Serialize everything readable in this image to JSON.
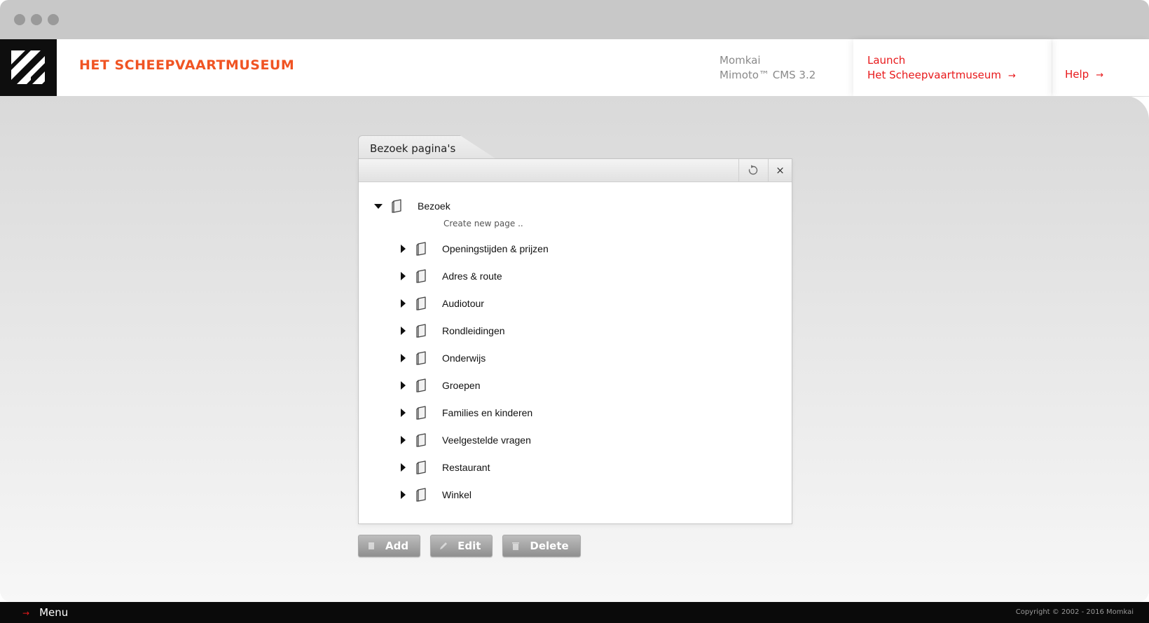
{
  "header": {
    "brand": "HET SCHEEPVAARTMUSEUM",
    "cms_vendor": "Momkai",
    "cms_name": "Mimoto™ CMS 3.2",
    "launch_line1": "Launch",
    "launch_line2": "Het Scheepvaartmuseum",
    "help": "Help",
    "arrow_glyph": "→"
  },
  "panel": {
    "tab_title": "Bezoek pagina's",
    "close_glyph": "×",
    "root": {
      "label": "Bezoek"
    },
    "create_new": "Create new page ..",
    "children": [
      {
        "label": "Openingstijden & prijzen"
      },
      {
        "label": "Adres & route"
      },
      {
        "label": "Audiotour"
      },
      {
        "label": "Rondleidingen"
      },
      {
        "label": "Onderwijs"
      },
      {
        "label": "Groepen"
      },
      {
        "label": "Families en kinderen"
      },
      {
        "label": "Veelgestelde vragen"
      },
      {
        "label": "Restaurant"
      },
      {
        "label": "Winkel"
      }
    ]
  },
  "actions": {
    "add": "Add",
    "edit": "Edit",
    "delete": "Delete"
  },
  "footer": {
    "menu": "Menu",
    "copyright": "Copyright © 2002 - 2016 Momkai"
  },
  "colors": {
    "brand_orange": "#f05423",
    "link_red": "#e8191b"
  },
  "icons": {
    "logo": "stripes-logo-icon",
    "refresh": "refresh-icon",
    "close": "close-icon",
    "page": "page-icon",
    "expand": "triangle-right-icon",
    "collapse": "triangle-down-icon"
  }
}
